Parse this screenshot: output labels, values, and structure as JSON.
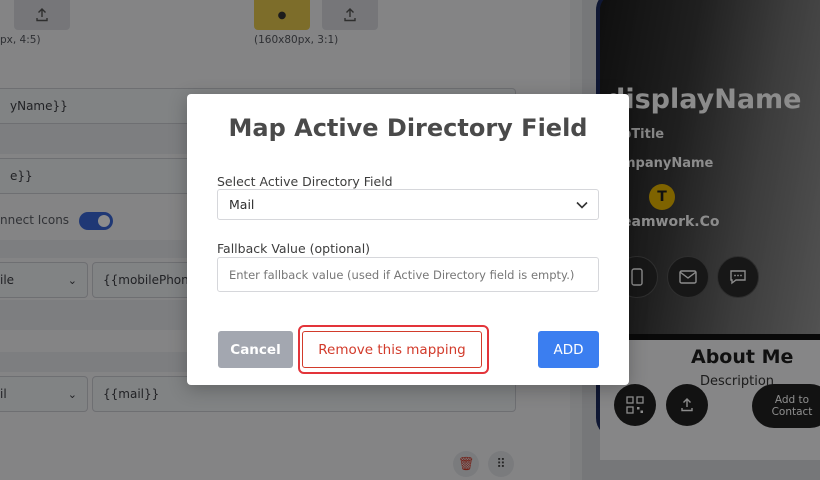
{
  "editor": {
    "upload_hint_right": "(160x80px, 3:1)",
    "upload_hint_left": "px, 4:5)",
    "field_display_name": "yName}}",
    "field_title": "e}}",
    "connect_icons_label": "nnect Icons",
    "mobile_select": "ile",
    "mobile_value": "{{mobilePhone",
    "mail_select": "il",
    "mail_value": "{{mail}}"
  },
  "preview": {
    "name": "displayName",
    "title": "bTitle",
    "company": "mpanyName",
    "logo_letter": "T",
    "team": "eamwork.Co",
    "about_heading": "About Me",
    "description": "Description",
    "add_contact_line1": "Add to",
    "add_contact_line2": "Contact"
  },
  "modal": {
    "title": "Map Active Directory Field",
    "select_label": "Select Active Directory Field",
    "select_value": "Mail",
    "fallback_label": "Fallback Value (optional)",
    "fallback_placeholder": "Enter fallback value (used if Active Directory field is empty.)",
    "fallback_value": "",
    "cancel_label": "Cancel",
    "remove_label": "Remove this mapping",
    "add_label": "ADD"
  },
  "colors": {
    "primary": "#3b7ef0",
    "danger": "#d23b2b",
    "highlight": "#e3343a",
    "cancel": "#a3a7b0"
  }
}
